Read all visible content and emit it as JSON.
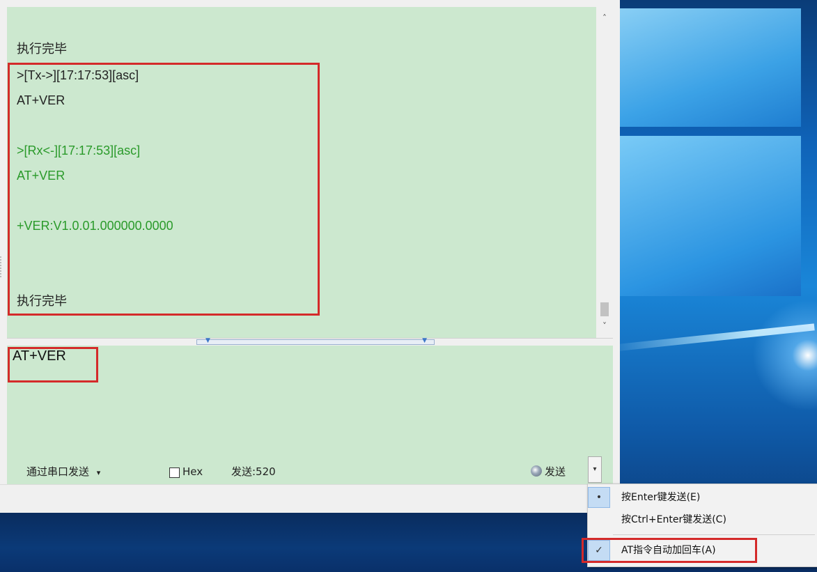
{
  "receive_log": [
    {
      "text": "执行完毕",
      "kind": "tx"
    },
    {
      "text": ">[Tx->][17:17:53][asc]",
      "kind": "tx"
    },
    {
      "text": "AT+VER",
      "kind": "tx"
    },
    {
      "text": ">[Rx<-][17:17:53][asc]",
      "kind": "rx"
    },
    {
      "text": "AT+VER",
      "kind": "rx"
    },
    {
      "text": "+VER:V1.0.01.000000.0000",
      "kind": "rx"
    },
    {
      "text": "执行完毕",
      "kind": "tx"
    }
  ],
  "send_area": {
    "text": "AT+VER"
  },
  "toolbar": {
    "send_via": "通过串口发送",
    "send_via_arrow": "▾",
    "hex_label": "Hex",
    "send_count": "发送:520",
    "send_label": "发送",
    "dropdown_arrow": "▾"
  },
  "scrollbar": {
    "up": "˄",
    "down": "˅"
  },
  "context_menu": {
    "items": [
      {
        "label": "按Enter键发送(E)",
        "mark": "•",
        "selected": true
      },
      {
        "label": "按Ctrl+Enter键发送(C)",
        "mark": "",
        "selected": false
      },
      {
        "label": "AT指令自动加回车(A)",
        "mark": "✓",
        "selected": true
      }
    ]
  },
  "colors": {
    "pane_bg": "#cce8cf",
    "tx_text": "#222222",
    "rx_text": "#2a9a2a",
    "highlight_border": "#d42a2a"
  },
  "icons": [
    "send-icon",
    "dropdown-arrow-icon",
    "check-icon",
    "radio-dot-icon",
    "scroll-up-icon",
    "scroll-down-icon"
  ]
}
